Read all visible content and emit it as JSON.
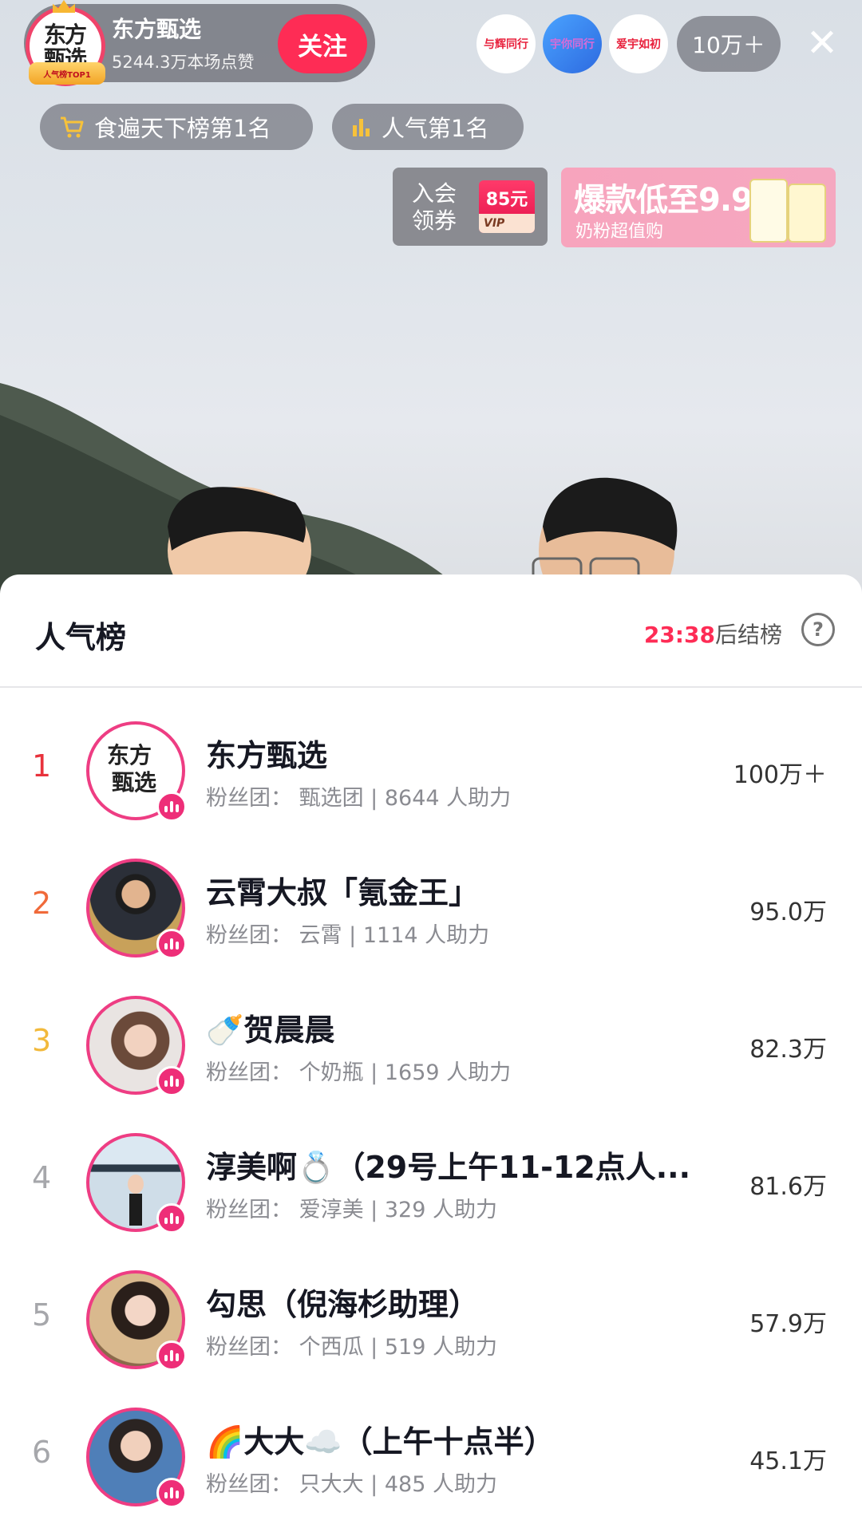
{
  "header": {
    "host_name": "东方甄选",
    "host_likes": "5244.3万本场点赞",
    "host_badge": "人气榜TOP1",
    "host_logo_text": "东方甄选",
    "follow_label": "关注",
    "viewers": [
      {
        "label": "与辉同行",
        "color": "#e8203c"
      },
      {
        "label": "宇你同行",
        "color": "#3b7bea"
      },
      {
        "label": "爱宇如初",
        "color": "#e8203c"
      }
    ],
    "viewer_count": "10万＋",
    "close_icon": "close-icon"
  },
  "chips": [
    {
      "label": "食遍天下榜第1名",
      "icon": "cart-icon"
    },
    {
      "label": "人气第1名",
      "icon": "bar-chart-icon"
    }
  ],
  "vip_card": {
    "line1": "入会",
    "line2": "领券",
    "amount": "85元",
    "tag": "VIP"
  },
  "promo": {
    "title": "爆款低至9.9",
    "subtitle": "奶粉超值购"
  },
  "panel": {
    "title": "人气榜",
    "countdown_time": "23:38",
    "countdown_suffix": "后结榜",
    "help_icon": "help-icon"
  },
  "colors": {
    "accent": "#fe2c55",
    "rank1": "#e8323c",
    "rank2": "#f06a3a",
    "rank3": "#f2b93b",
    "rank_other": "#a6a7ab",
    "avatar_ring": "#ee3d83"
  },
  "rows": [
    {
      "rank": "1",
      "name": "东方甄选",
      "fans": "粉丝团：  甄选团 | 8644 人助力",
      "score": "100万＋"
    },
    {
      "rank": "2",
      "name": "云霄大叔「氪金王」",
      "fans": "粉丝团：  云霄 | 1114 人助力",
      "score": "95.0万"
    },
    {
      "rank": "3",
      "name": "🍼贺晨晨",
      "fans": "粉丝团：  个奶瓶 | 1659 人助力",
      "score": "82.3万"
    },
    {
      "rank": "4",
      "name": "淳美啊💍（29号上午11-12点人...",
      "fans": "粉丝团：  爱淳美 | 329 人助力",
      "score": "81.6万"
    },
    {
      "rank": "5",
      "name": "勾思（倪海杉助理）",
      "fans": "粉丝团：  个西瓜 | 519 人助力",
      "score": "57.9万"
    },
    {
      "rank": "6",
      "name": "🌈大大☁️（上午十点半）",
      "fans": "粉丝团：  只大大 | 485 人助力",
      "score": "45.1万"
    }
  ]
}
